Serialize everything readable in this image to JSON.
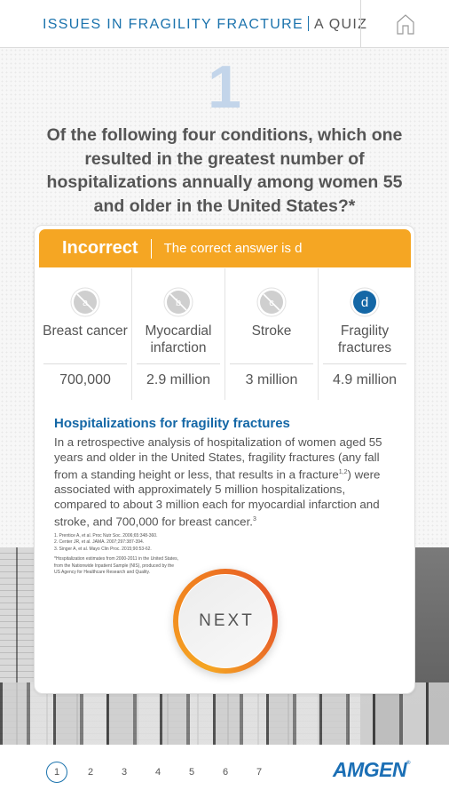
{
  "header": {
    "title": "ISSUES IN FRAGILITY FRACTURE",
    "subtitle": "A QUIZ",
    "home_icon": "home-icon"
  },
  "question": {
    "number": "1",
    "text": "Of the following four conditions, which one resulted in the greatest number of hospitalizations annually among women 55 and older in the United States?*"
  },
  "result": {
    "status": "Incorrect",
    "message": "The correct answer is d",
    "colors": {
      "banner": "#f5a623",
      "correct": "#1467a6",
      "disabled": "#cfcfcf"
    }
  },
  "options": [
    {
      "letter": "a",
      "label": "Breast cancer",
      "value": "700,000",
      "state": "disabled"
    },
    {
      "letter": "b",
      "label": "Myocardial infarction",
      "value": "2.9 million",
      "state": "disabled"
    },
    {
      "letter": "c",
      "label": "Stroke",
      "value": "3 million",
      "state": "disabled"
    },
    {
      "letter": "d",
      "label": "Fragility fractures",
      "value": "4.9 million",
      "state": "correct"
    }
  ],
  "explanation": {
    "heading": "Hospitalizations for fragility fractures",
    "body_part1": "In a retrospective analysis of hospitalization of women aged 55 years and older in the United States, fragility fractures (any fall from a standing height or less, that results in a fracture",
    "sup1": "1,2",
    "body_part2": ") were associated with approximately 5 million hospitalizations, compared to about 3 million each for myocardial infarction and stroke, and 700,000 for breast cancer.",
    "sup2": "3"
  },
  "references": [
    "1. Prentice A, et al. Proc Nutr Soc. 2006;65:348-360.",
    "2. Center JR, et al. JAMA. 2007;297:387-394.",
    "3. Singer A, et al. Mayo Clin Proc. 2015;90:53-62."
  ],
  "footnote": "*Hospitalization estimates from 2000-2011 in the United States, from the Nationwide Inpatient Sample (NIS), produced by the US Agency for Healthcare Research and Quality.",
  "next_button": {
    "label": "NEXT"
  },
  "pager": {
    "pages": [
      "1",
      "2",
      "3",
      "4",
      "5",
      "6",
      "7"
    ],
    "current": "1"
  },
  "brand": {
    "logo_text": "AMGEN",
    "registered": "®"
  }
}
